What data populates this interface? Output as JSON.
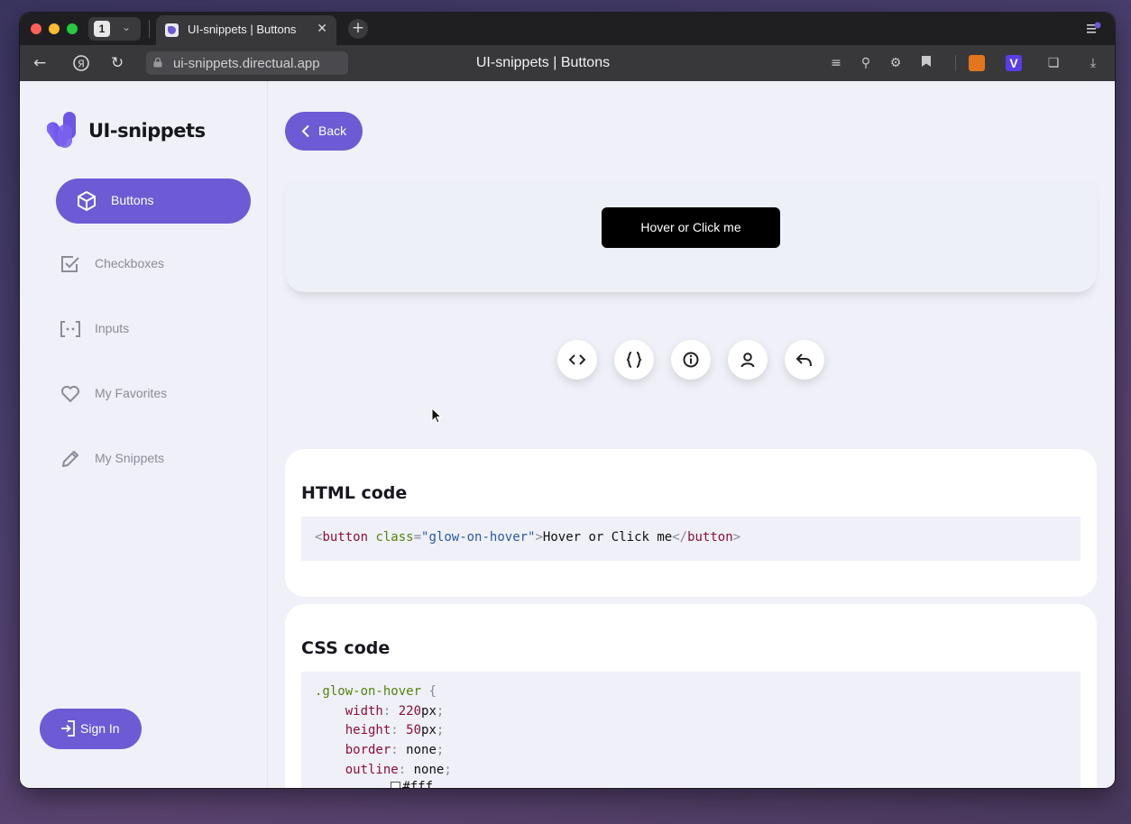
{
  "browser": {
    "tab_count": "1",
    "tab_title": "UI-snippets | Buttons",
    "url": "ui-snippets.directual.app",
    "page_title": "UI-snippets | Buttons"
  },
  "sidebar": {
    "logo_text": "UI-snippets",
    "items": [
      {
        "label": "Buttons",
        "icon": "cube-icon",
        "active": true
      },
      {
        "label": "Checkboxes",
        "icon": "checkbox-icon"
      },
      {
        "label": "Inputs",
        "icon": "input-brackets-icon"
      },
      {
        "label": "My Favorites",
        "icon": "heart-icon"
      },
      {
        "label": "My Snippets",
        "icon": "pencil-icon"
      }
    ],
    "sign_in_label": "Sign In"
  },
  "main": {
    "back_label": "Back",
    "preview_button_label": "Hover or Click me",
    "toolbar": [
      "code-icon",
      "braces-icon",
      "info-icon",
      "user-icon",
      "undo-icon"
    ],
    "html_card": {
      "title": "HTML code",
      "code": {
        "open_tag": "button",
        "attr": "class",
        "attr_value": "\"glow-on-hover\"",
        "text": "Hover or Click me",
        "close_tag": "button"
      }
    },
    "css_card": {
      "title": "CSS code",
      "selector": ".glow-on-hover",
      "props": [
        {
          "prop": "width",
          "num": "220",
          "unit": "px"
        },
        {
          "prop": "height",
          "num": "50",
          "unit": "px"
        },
        {
          "prop": "border",
          "value": "none"
        },
        {
          "prop": "outline",
          "value": "none"
        }
      ],
      "partial_value": "#fff"
    }
  },
  "colors": {
    "accent": "#6c5bd4",
    "page_bg": "#eff0f8",
    "sidebar_text": "#8a8c99"
  }
}
